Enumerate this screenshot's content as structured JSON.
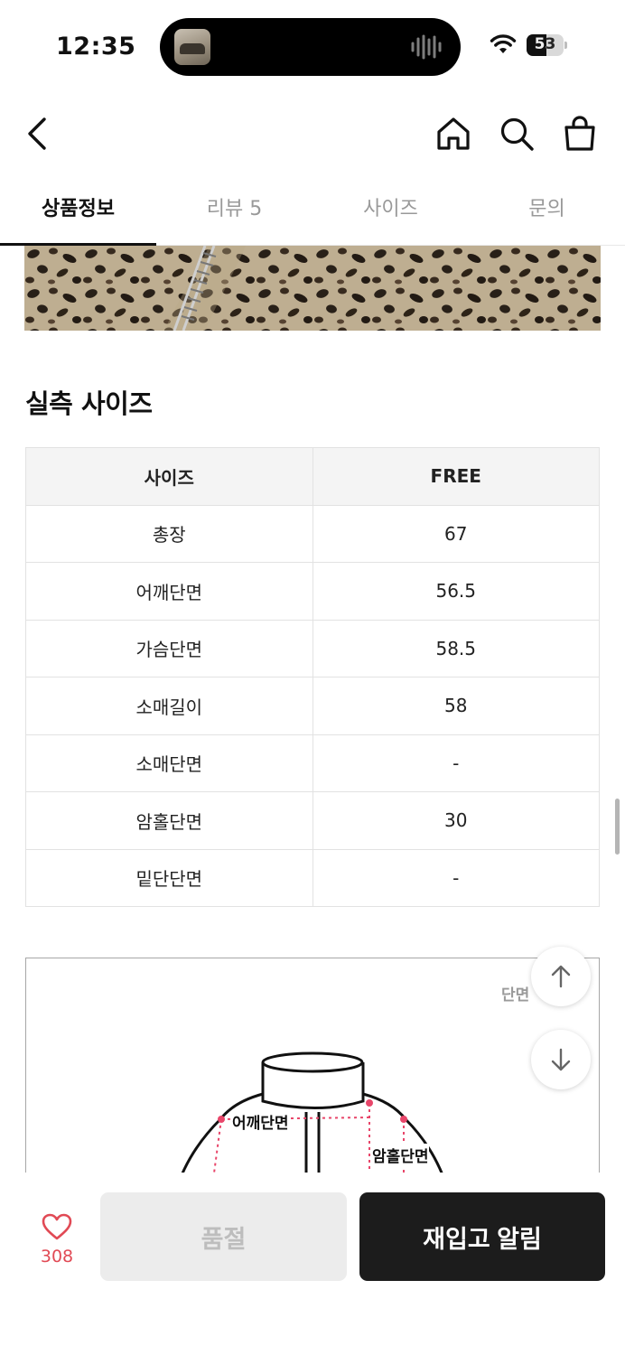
{
  "status_bar": {
    "time": "12:35",
    "battery": "53",
    "battery_level": 0.53
  },
  "header": {
    "back_icon": "chevron-left-icon",
    "home_icon": "home-icon",
    "search_icon": "search-icon",
    "cart_icon": "shopping-bag-icon"
  },
  "tabs": [
    {
      "label": "상품정보",
      "active": true
    },
    {
      "label": "리뷰 5",
      "active": false
    },
    {
      "label": "사이즈",
      "active": false
    },
    {
      "label": "문의",
      "active": false
    }
  ],
  "size_section": {
    "title": "실측 사이즈",
    "header": [
      "사이즈",
      "FREE"
    ],
    "rows": [
      [
        "총장",
        "67"
      ],
      [
        "어깨단면",
        "56.5"
      ],
      [
        "가슴단면",
        "58.5"
      ],
      [
        "소매길이",
        "58"
      ],
      [
        "소매단면",
        "-"
      ],
      [
        "암홀단면",
        "30"
      ],
      [
        "밑단단면",
        "-"
      ]
    ]
  },
  "diagram": {
    "corner_label": "단면",
    "shoulder_label": "어깨단면",
    "armhole_label": "암홀단면"
  },
  "bottom_bar": {
    "like_count": "308",
    "soldout_label": "품절",
    "restock_label": "재입고 알림"
  },
  "colors": {
    "accent_red": "#e14a55",
    "dark_button": "#1c1c1c"
  }
}
